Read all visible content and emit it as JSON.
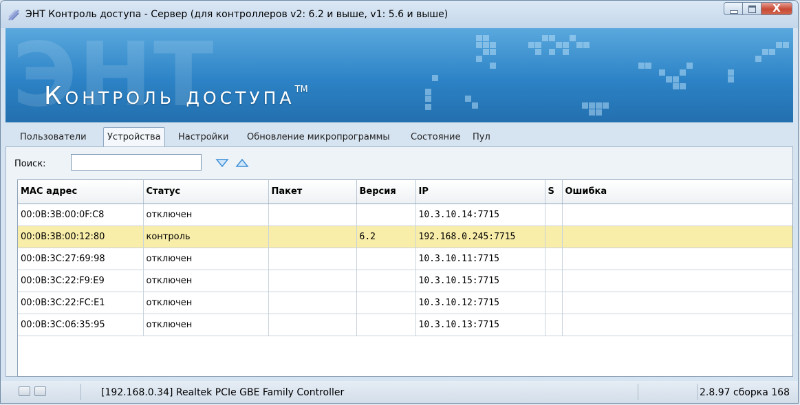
{
  "window": {
    "title": "ЭНТ Контроль доступа - Сервер (для контроллеров v2: 6.2  и выше, v1: 5.6 и выше)",
    "close_glyph": "X"
  },
  "banner": {
    "bg_letters": "ЭНТ",
    "title": "Контроль доступа",
    "tm": "TM"
  },
  "tabs": [
    {
      "label": "Пользователи",
      "active": false
    },
    {
      "label": "Устройства",
      "active": true
    },
    {
      "label": "Настройки",
      "active": false
    },
    {
      "label": "Обновление микропрограммы",
      "active": false
    },
    {
      "label": "Состояние",
      "active": false
    },
    {
      "label": "Пул",
      "active": false
    }
  ],
  "search": {
    "label": "Поиск:",
    "value": "",
    "placeholder": "",
    "down_icon": "triangle-down-icon",
    "up_icon": "triangle-up-icon"
  },
  "table": {
    "columns": [
      "MAC адрес",
      "Статус",
      "Пакет",
      "Версия",
      "IP",
      "S",
      "Ошибка"
    ],
    "rows": [
      {
        "mac": "00:0B:3B:00:0F:C8",
        "status": "отключен",
        "packet": "",
        "version": "",
        "ip": "10.3.10.14:7715",
        "s": "",
        "error": "",
        "selected": false
      },
      {
        "mac": "00:0B:3B:00:12:80",
        "status": "контроль",
        "packet": "",
        "version": "6.2",
        "ip": "192.168.0.245:7715",
        "s": "",
        "error": "",
        "selected": true
      },
      {
        "mac": "00:0B:3C:27:69:98",
        "status": "отключен",
        "packet": "",
        "version": "",
        "ip": "10.3.10.11:7715",
        "s": "",
        "error": "",
        "selected": false
      },
      {
        "mac": "00:0B:3C:22:F9:E9",
        "status": "отключен",
        "packet": "",
        "version": "",
        "ip": "10.3.10.15:7715",
        "s": "",
        "error": "",
        "selected": false
      },
      {
        "mac": "00:0B:3C:22:FC:E1",
        "status": "отключен",
        "packet": "",
        "version": "",
        "ip": "10.3.10.12:7715",
        "s": "",
        "error": "",
        "selected": false
      },
      {
        "mac": "00:0B:3C:06:35:95",
        "status": "отключен",
        "packet": "",
        "version": "",
        "ip": "10.3.10.13:7715",
        "s": "",
        "error": "",
        "selected": false
      }
    ]
  },
  "statusbar": {
    "adapter": "[192.168.0.34] Realtek PCIe GBE Family Controller",
    "version": "2.8.97 сборка 168"
  },
  "colors": {
    "banner_top": "#5aa8dd",
    "banner_bottom": "#236fae",
    "selected_row": "#f8eda9",
    "close_button": "#c74a34"
  }
}
